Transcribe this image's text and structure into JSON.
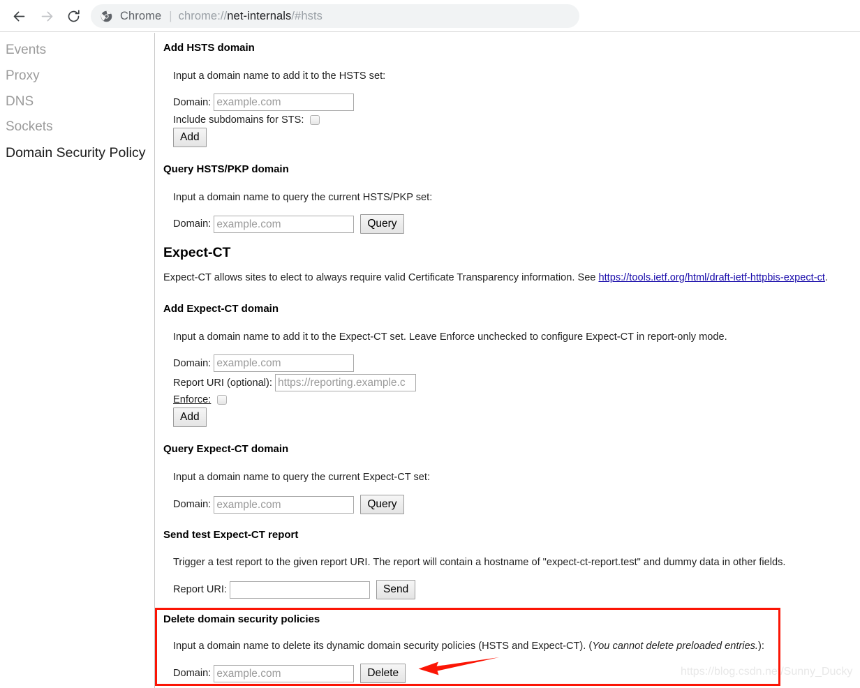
{
  "browser": {
    "back_icon": "arrow-left-icon",
    "forward_icon": "arrow-right-icon",
    "reload_icon": "reload-icon",
    "brand_icon": "chrome-logo-icon",
    "brand_label": "Chrome",
    "separator": "|",
    "url_scheme": "chrome://",
    "url_host": "net-internals",
    "url_rest": "/#hsts",
    "url_full": "chrome://net-internals/#hsts"
  },
  "sidebar": {
    "items": [
      {
        "label": "Events",
        "active": false
      },
      {
        "label": "Proxy",
        "active": false
      },
      {
        "label": "DNS",
        "active": false
      },
      {
        "label": "Sockets",
        "active": false
      },
      {
        "label": "Domain Security Policy",
        "active": true
      }
    ]
  },
  "main": {
    "add_hsts": {
      "title": "Add HSTS domain",
      "description": "Input a domain name to add it to the HSTS set:",
      "domain_label": "Domain:",
      "domain_placeholder": "example.com",
      "domain_value": "",
      "subdomains_label": "Include subdomains for STS:",
      "subdomains_checked": false,
      "add_button": "Add"
    },
    "query_hsts": {
      "title": "Query HSTS/PKP domain",
      "description": "Input a domain name to query the current HSTS/PKP set:",
      "domain_label": "Domain:",
      "domain_placeholder": "example.com",
      "domain_value": "",
      "query_button": "Query"
    },
    "expect_ct": {
      "title": "Expect-CT",
      "description_before": "Expect-CT allows sites to elect to always require valid Certificate Transparency information. See ",
      "link_text": "https://tools.ietf.org/html/draft-ietf-httpbis-expect-ct",
      "link_href": "https://tools.ietf.org/html/draft-ietf-httpbis-expect-ct",
      "description_after": "."
    },
    "add_expect_ct": {
      "title": "Add Expect-CT domain",
      "description": "Input a domain name to add it to the Expect-CT set. Leave Enforce unchecked to configure Expect-CT in report-only mode.",
      "domain_label": "Domain:",
      "domain_placeholder": "example.com",
      "domain_value": "",
      "report_uri_label": "Report URI (optional):",
      "report_uri_placeholder": "https://reporting.example.c",
      "report_uri_value": "",
      "enforce_label": "Enforce:",
      "enforce_checked": false,
      "add_button": "Add"
    },
    "query_expect_ct": {
      "title": "Query Expect-CT domain",
      "description": "Input a domain name to query the current Expect-CT set:",
      "domain_label": "Domain:",
      "domain_placeholder": "example.com",
      "domain_value": "",
      "query_button": "Query"
    },
    "send_test_report": {
      "title": "Send test Expect-CT report",
      "description": "Trigger a test report to the given report URI. The report will contain a hostname of \"expect-ct-report.test\" and dummy data in other fields.",
      "report_uri_label": "Report URI:",
      "report_uri_placeholder": "",
      "report_uri_value": "",
      "send_button": "Send"
    },
    "delete_policies": {
      "title": "Delete domain security policies",
      "description_plain": "Input a domain name to delete its dynamic domain security policies (HSTS and Expect-CT). (",
      "description_italic": "You cannot delete preloaded entries.",
      "description_tail": "):",
      "domain_label": "Domain:",
      "domain_placeholder": "example.com",
      "domain_value": "",
      "delete_button": "Delete"
    }
  },
  "annotations": {
    "highlight_color": "#fb1505",
    "arrow_icon": "left-arrow-annotation",
    "watermark": "https://blog.csdn.net/Sunny_Ducky"
  }
}
